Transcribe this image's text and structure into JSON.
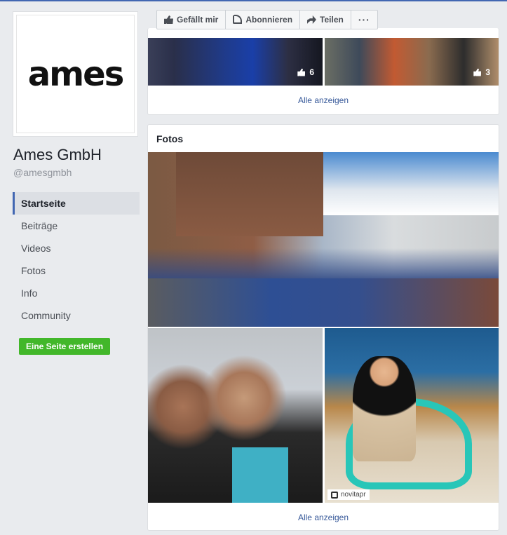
{
  "page": {
    "logo_text": "ames",
    "name": "Ames GmbH",
    "handle": "@amesgmbh"
  },
  "nav": {
    "items": [
      {
        "label": "Startseite",
        "active": true
      },
      {
        "label": "Beiträge"
      },
      {
        "label": "Videos"
      },
      {
        "label": "Fotos"
      },
      {
        "label": "Info"
      },
      {
        "label": "Community"
      }
    ],
    "create_button": "Eine Seite erstellen"
  },
  "actionbar": {
    "like": "Gefällt mir",
    "subscribe": "Abonnieren",
    "share": "Teilen",
    "more": "···"
  },
  "videos": {
    "thumbs": [
      {
        "likes": "6"
      },
      {
        "likes": "3"
      }
    ],
    "see_all": "Alle anzeigen"
  },
  "fotos": {
    "title": "Fotos",
    "repost_user": "novitapr",
    "see_all": "Alle anzeigen"
  },
  "colors": {
    "accent": "#4267b2",
    "link": "#365899",
    "create_button": "#42b72a"
  }
}
